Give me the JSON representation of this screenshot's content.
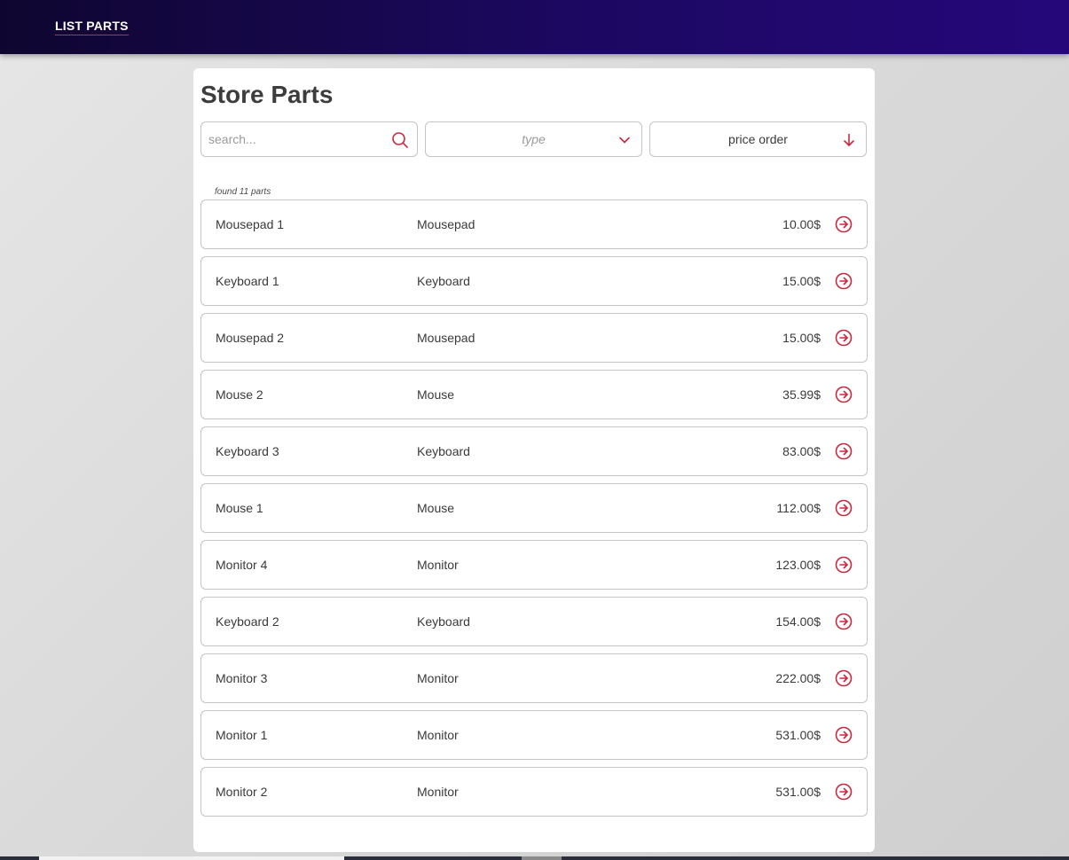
{
  "nav": {
    "link_label": "LIST PARTS"
  },
  "page": {
    "title": "Store Parts"
  },
  "filters": {
    "search_placeholder": "search...",
    "search_icon": "search-icon",
    "type_placeholder": "type",
    "type_icon": "chevron-down-icon",
    "order_value": "price order",
    "order_icon": "arrow-down-icon"
  },
  "results": {
    "count_text": "found 11 parts"
  },
  "parts": [
    {
      "name": "Mousepad 1",
      "type": "Mousepad",
      "price": "10.00$"
    },
    {
      "name": "Keyboard 1",
      "type": "Keyboard",
      "price": "15.00$"
    },
    {
      "name": "Mousepad 2",
      "type": "Mousepad",
      "price": "15.00$"
    },
    {
      "name": "Mouse 2",
      "type": "Mouse",
      "price": "35.99$"
    },
    {
      "name": "Keyboard 3",
      "type": "Keyboard",
      "price": "83.00$"
    },
    {
      "name": "Mouse 1",
      "type": "Mouse",
      "price": "112.00$"
    },
    {
      "name": "Monitor 4",
      "type": "Monitor",
      "price": "123.00$"
    },
    {
      "name": "Keyboard 2",
      "type": "Keyboard",
      "price": "154.00$"
    },
    {
      "name": "Monitor 3",
      "type": "Monitor",
      "price": "222.00$"
    },
    {
      "name": "Monitor 1",
      "type": "Monitor",
      "price": "531.00$"
    },
    {
      "name": "Monitor 2",
      "type": "Monitor",
      "price": "531.00$"
    }
  ],
  "row_icon": "arrow-right-circle-icon",
  "colors": {
    "header_dark": "#0f0630",
    "header_light": "#25077a",
    "accent": "#c9283f",
    "text": "#3a3a3a",
    "border": "#c4c4c4"
  }
}
